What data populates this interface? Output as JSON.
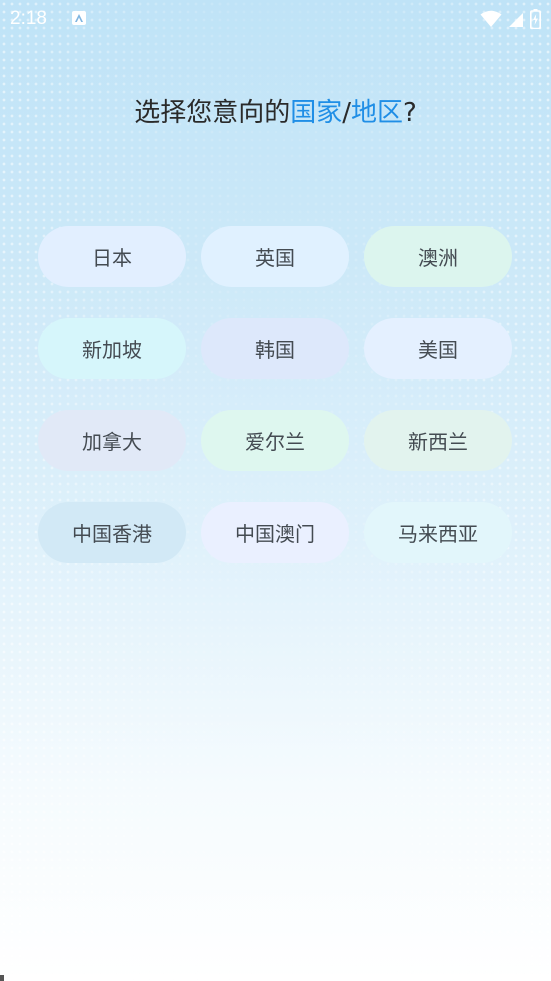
{
  "status_bar": {
    "time": "2:18",
    "app_icon": "a-app-icon",
    "icons": [
      "wifi-icon",
      "signal-icon",
      "battery-icon"
    ]
  },
  "page": {
    "title_prefix": "选择您意向的",
    "title_hl1": "国家",
    "title_sep": "/",
    "title_hl2": "地区",
    "title_suffix": "?",
    "accent_color": "#1f8ee6"
  },
  "options": [
    {
      "label": "日本",
      "bg": "#e2efff"
    },
    {
      "label": "英国",
      "bg": "#e0f1ff"
    },
    {
      "label": "澳洲",
      "bg": "#dcf5ee"
    },
    {
      "label": "新加坡",
      "bg": "#d6f6fb"
    },
    {
      "label": "韩国",
      "bg": "#dde8fb"
    },
    {
      "label": "美国",
      "bg": "#e4f0ff"
    },
    {
      "label": "加拿大",
      "bg": "#e1e9f7"
    },
    {
      "label": "爱尔兰",
      "bg": "#def7ef"
    },
    {
      "label": "新西兰",
      "bg": "#e2f3ee"
    },
    {
      "label": "中国香港",
      "bg": "#d2e9f6"
    },
    {
      "label": "中国澳门",
      "bg": "#eaf0ff"
    },
    {
      "label": "马来西亚",
      "bg": "#e2f6fb"
    }
  ]
}
